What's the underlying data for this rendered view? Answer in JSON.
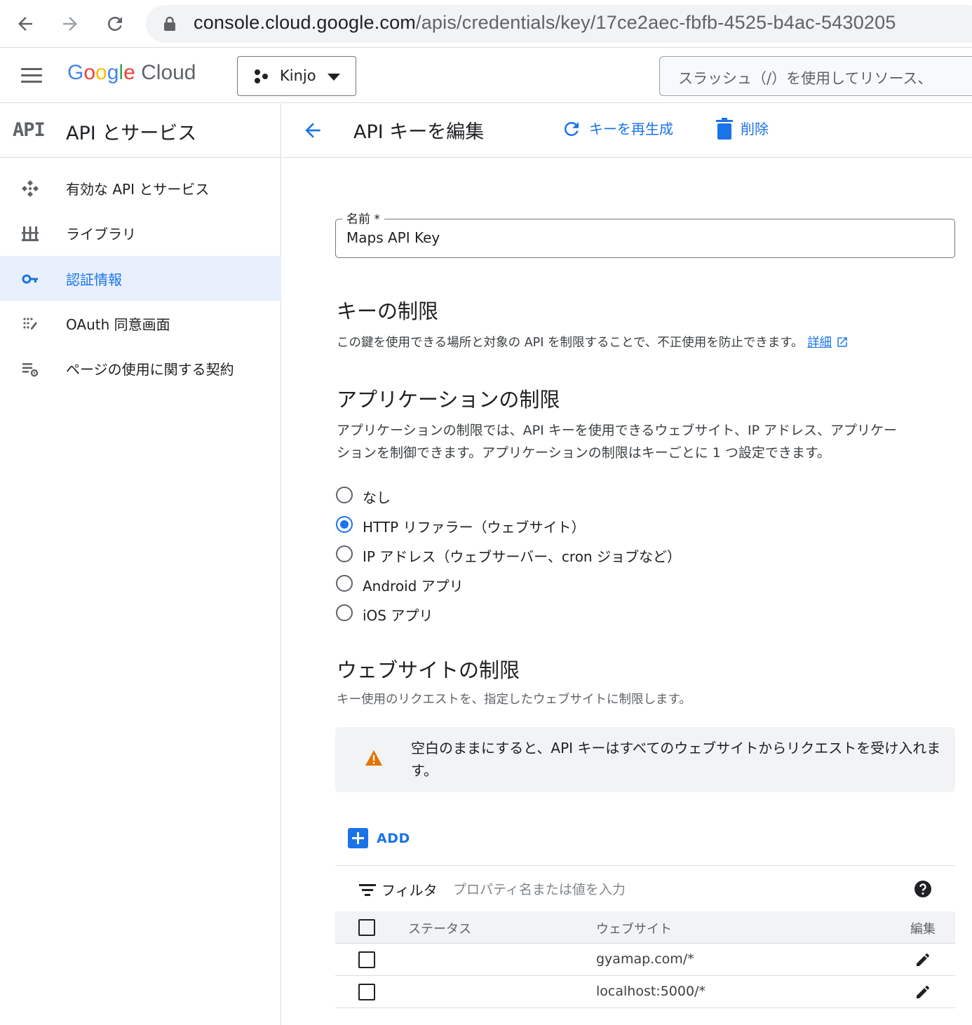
{
  "browser": {
    "url_host": "console.cloud.google.com",
    "url_path": "/apis/credentials/key/17ce2aec-fbfb-4525-b4ac-5430205"
  },
  "header": {
    "logo_google": "Google",
    "logo_cloud": "Cloud",
    "project": "Kinjo",
    "search_placeholder": "スラッシュ（/）を使用してリソース、"
  },
  "sidebar": {
    "badge": "API",
    "title": "API とサービス",
    "items": [
      {
        "label": "有効な API とサービス",
        "icon": "hub-icon"
      },
      {
        "label": "ライブラリ",
        "icon": "library-icon"
      },
      {
        "label": "認証情報",
        "icon": "key-icon",
        "active": true
      },
      {
        "label": "OAuth 同意画面",
        "icon": "consent-icon"
      },
      {
        "label": "ページの使用に関する契約",
        "icon": "settings-list-icon"
      }
    ]
  },
  "page": {
    "title": "API キーを編集",
    "regenerate_label": "キーを再生成",
    "delete_label": "削除"
  },
  "name_field": {
    "label": "名前 *",
    "value": "Maps API Key"
  },
  "key_restrictions": {
    "heading": "キーの制限",
    "description": "この鍵を使用できる場所と対象の API を制限することで、不正使用を防止できます。",
    "details_link": "詳細"
  },
  "app_restrictions": {
    "heading": "アプリケーションの制限",
    "description_1": "アプリケーションの制限では、API キーを使用できるウェブサイト、IP アドレス、アプリケー",
    "description_2": "ションを制御できます。アプリケーションの制限はキーごとに 1 つ設定できます。",
    "options": [
      {
        "label": "なし",
        "selected": false
      },
      {
        "label": "HTTP リファラー（ウェブサイト）",
        "selected": true
      },
      {
        "label": "IP アドレス（ウェブサーバー、cron ジョブなど）",
        "selected": false
      },
      {
        "label": "Android アプリ",
        "selected": false
      },
      {
        "label": "iOS アプリ",
        "selected": false
      }
    ]
  },
  "website_restrictions": {
    "heading": "ウェブサイトの制限",
    "description": "キー使用のリクエストを、指定したウェブサイトに制限します。",
    "warning": "空白のままにすると、API キーはすべてのウェブサイトからリクエストを受け入れます。",
    "add_label": "ADD",
    "filter_label": "フィルタ",
    "filter_placeholder": "プロパティ名または値を入力",
    "columns": {
      "status": "ステータス",
      "website": "ウェブサイト",
      "edit": "編集"
    },
    "rows": [
      {
        "status": "",
        "website": "gyamap.com/*"
      },
      {
        "status": "",
        "website": "localhost:5000/*"
      }
    ]
  },
  "colors": {
    "accent": "#1a73e8",
    "warning": "#e37400",
    "active_bg": "#e8f0fe"
  }
}
